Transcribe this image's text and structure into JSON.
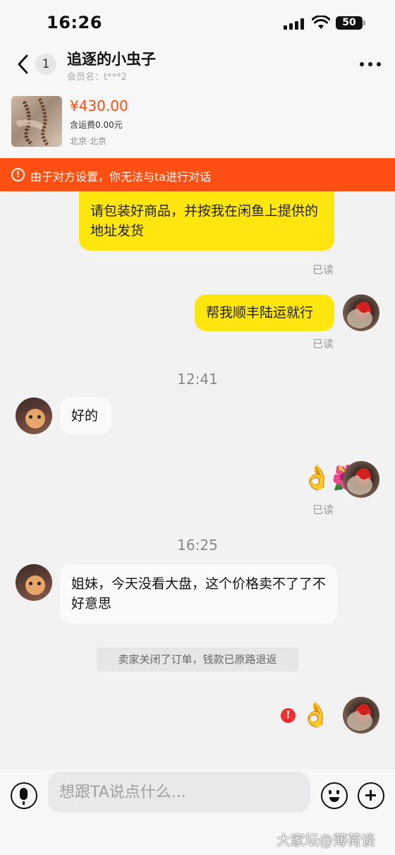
{
  "status_bar": {
    "time": "16:26",
    "battery": "50",
    "icons": [
      "cellular-signal-icon",
      "wifi-icon",
      "battery-icon"
    ]
  },
  "header": {
    "back_icon": "chevron-left-icon",
    "unread_count": "1",
    "nickname": "追逐的小虫子",
    "member": "会员名：t***2",
    "more_icon": "more-dots-icon"
  },
  "product": {
    "price": "¥430.00",
    "shipping": "含运费0.00元",
    "location": "北京·北京"
  },
  "banner": {
    "icon": "!",
    "text": "由于对方设置，你无法与ta进行对话"
  },
  "messages": {
    "m1": {
      "text": "请包装好商品，并按我在闲鱼上提供的地址发货",
      "status": "已读"
    },
    "m2": {
      "text": "帮我顺丰陆运就行",
      "status": "已读"
    },
    "time1": "12:41",
    "m3": {
      "text": "好的"
    },
    "m4": {
      "emoji": "👌🌺",
      "status": "已读"
    },
    "time2": "16:25",
    "m5": {
      "text": "姐妹，今天没看大盘，这个价格卖不了了不好意思"
    },
    "system": "卖家关闭了订单，钱款已原路退返",
    "m6": {
      "emoji": "👌",
      "error": "!"
    }
  },
  "input_bar": {
    "placeholder": "想跟TA说点什么...",
    "watermark": "大家坛@薄荷谈"
  },
  "colors": {
    "accent": "#ff4f12",
    "bubble_self": "#ffe60f",
    "price": "#ff4a10"
  }
}
